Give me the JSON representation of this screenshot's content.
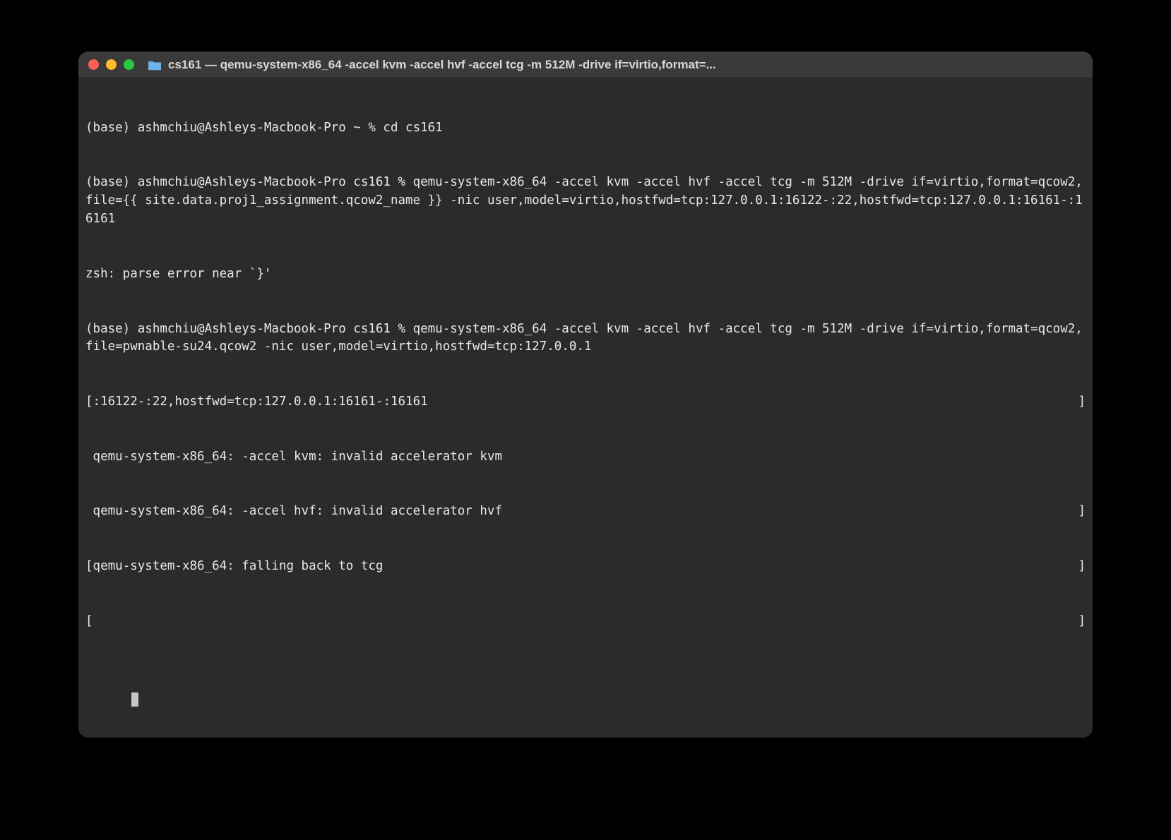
{
  "window": {
    "title": "cs161 — qemu-system-x86_64 -accel kvm -accel hvf -accel tcg -m 512M -drive if=virtio,format=..."
  },
  "terminal": {
    "lines": [
      "(base) ashmchiu@Ashleys-Macbook-Pro ~ % cd cs161",
      "(base) ashmchiu@Ashleys-Macbook-Pro cs161 % qemu-system-x86_64 -accel kvm -accel hvf -accel tcg -m 512M -drive if=virtio,format=qcow2,file={{ site.data.proj1_assignment.qcow2_name }} -nic user,model=virtio,hostfwd=tcp:127.0.0.1:16122-:22,hostfwd=tcp:127.0.0.1:16161-:16161",
      "zsh: parse error near `}'",
      "(base) ashmchiu@Ashleys-Macbook-Pro cs161 % qemu-system-x86_64 -accel kvm -accel hvf -accel tcg -m 512M -drive if=virtio,format=qcow2,file=pwnable-su24.qcow2 -nic user,model=virtio,hostfwd=tcp:127.0.0.1"
    ],
    "bracket_lines": [
      {
        "left": ":16122-:22,hostfwd=tcp:127.0.0.1:16161-:16161",
        "right": "]"
      },
      {
        "left": "qemu-system-x86_64: -accel kvm: invalid accelerator kvm",
        "right": ""
      },
      {
        "left": "qemu-system-x86_64: -accel hvf: invalid accelerator hvf",
        "right": "]"
      },
      {
        "left": "qemu-system-x86_64: falling back to tcg",
        "right": "]"
      },
      {
        "left": "",
        "right": "]"
      }
    ],
    "open_bracket": "["
  }
}
